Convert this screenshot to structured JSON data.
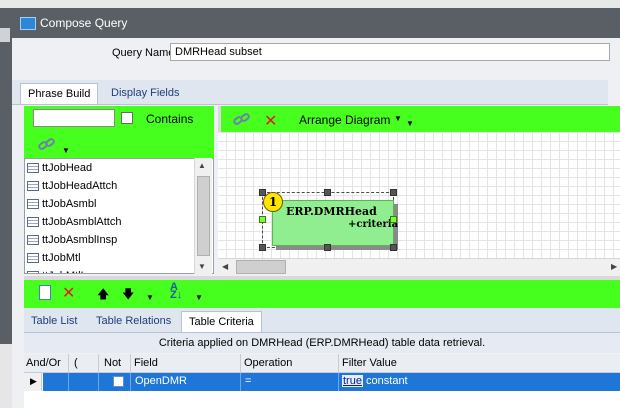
{
  "window": {
    "title": "Compose Query"
  },
  "query": {
    "name_label": "Query Name:",
    "name_value": "DMRHead subset"
  },
  "top_tabs": [
    {
      "label": "Phrase Build",
      "active": true
    },
    {
      "label": "Display Fields",
      "active": false
    }
  ],
  "left_panel": {
    "search_value": "",
    "contains_label": "Contains",
    "contains_checked": false,
    "tables": [
      "ttJobHead",
      "ttJobHeadAttch",
      "ttJobAsmbl",
      "ttJobAsmblAttch",
      "ttJobAsmblInsp",
      "ttJobMtl",
      "ttJobMtlInsp"
    ]
  },
  "diagram": {
    "toolbar": {
      "arrange_label": "Arrange Diagram"
    },
    "node": {
      "badge": "1",
      "title": "ERP.DMRHead",
      "subtitle": "+criteria"
    }
  },
  "bottom_tabs": [
    {
      "label": "Table List",
      "active": false
    },
    {
      "label": "Table Relations",
      "active": false
    },
    {
      "label": "Table Criteria",
      "active": true
    }
  ],
  "criteria": {
    "caption": "Criteria applied on DMRHead (ERP.DMRHead)  table data retrieval.",
    "columns": [
      "And/Or",
      "(",
      "Not",
      "Field",
      "Operation",
      "Filter Value"
    ],
    "rows": [
      {
        "andor": "",
        "paren": "",
        "not": false,
        "field": "OpenDMR",
        "operation": "=",
        "filter_link": "true",
        "filter_type": "constant"
      }
    ]
  },
  "colors": {
    "toolbar_green": "#47ff1f",
    "selection_blue": "#1e77d8",
    "node_green": "#90ee90",
    "titlebar": "#5a5f66"
  },
  "icons": [
    "window-icon",
    "link-icon",
    "delete-icon",
    "new-document-icon",
    "move-up-icon",
    "move-down-icon",
    "sort-az-icon",
    "table-icon"
  ]
}
